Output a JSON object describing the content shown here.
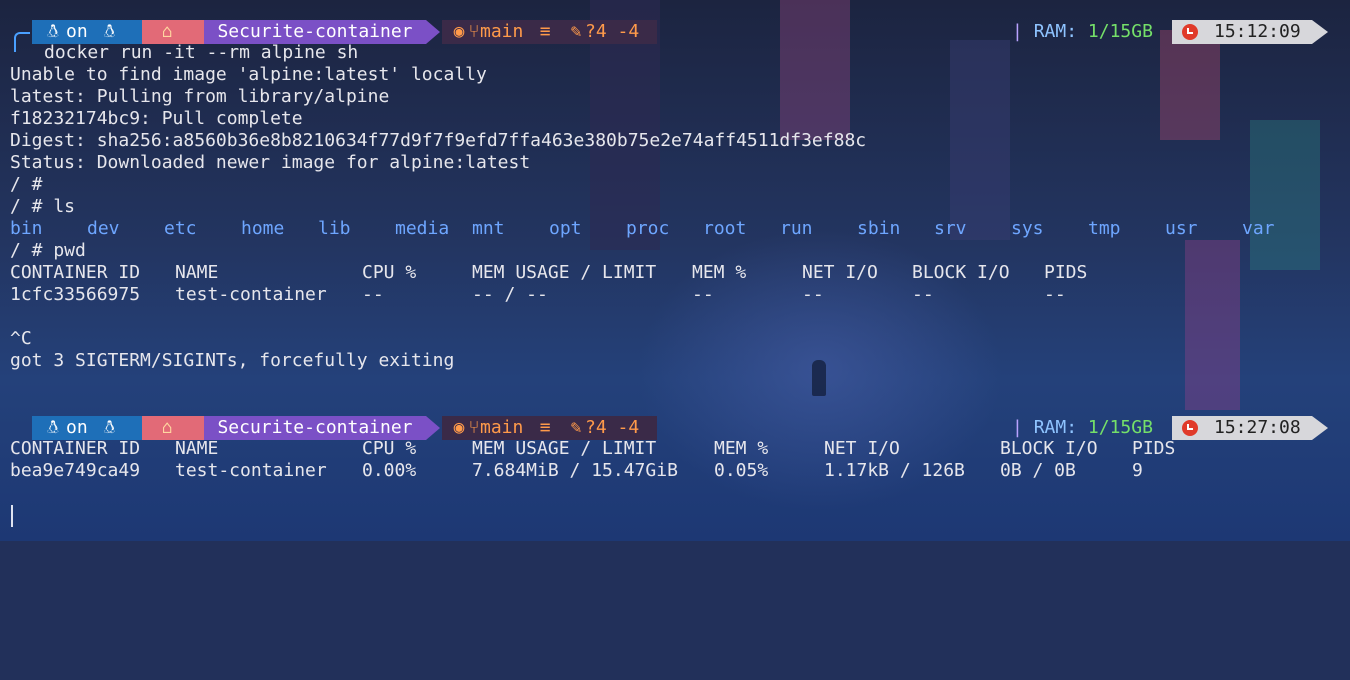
{
  "prompts": [
    {
      "os_icon": "linux-penguin-icon",
      "on_text": "on",
      "home_icon": "home-icon",
      "directory": "Securite-container",
      "git_icon": "github-icon",
      "branch_icon": "git-branch-icon",
      "branch": "main",
      "ahead_icon": "equal-sign-icon",
      "edit_icon": "edit-icon",
      "git_status": "?4 -4",
      "pipe": "|",
      "ram_label": "RAM:",
      "ram_value": "1/15GB",
      "time_icon": "alarm-clock-icon",
      "time": "15:12:09"
    },
    {
      "os_icon": "linux-penguin-icon",
      "on_text": "on",
      "home_icon": "home-icon",
      "directory": "Securite-container",
      "git_icon": "github-icon",
      "branch_icon": "git-branch-icon",
      "branch": "main",
      "ahead_icon": "equal-sign-icon",
      "edit_icon": "edit-icon",
      "git_status": "?4 -4",
      "pipe": "|",
      "ram_label": "RAM:",
      "ram_value": "1/15GB",
      "time_icon": "alarm-clock-icon",
      "time": "15:27:08"
    }
  ],
  "block1": {
    "command": "docker run -it --rm alpine sh",
    "output": [
      "Unable to find image 'alpine:latest' locally",
      "latest: Pulling from library/alpine",
      "f18232174bc9: Pull complete",
      "Digest: sha256:a8560b36e8b8210634f77d9f7f9efd7ffa463e380b75e2e74aff4511df3ef88c",
      "Status: Downloaded newer image for alpine:latest",
      "/ #",
      "/ # ls"
    ],
    "ls_items": [
      "bin",
      "dev",
      "etc",
      "home",
      "lib",
      "media",
      "mnt",
      "opt",
      "proc",
      "root",
      "run",
      "sbin",
      "srv",
      "sys",
      "tmp",
      "usr",
      "var"
    ],
    "pwd_line": "/ # pwd",
    "stats_headers": [
      "CONTAINER ID",
      "NAME",
      "CPU %",
      "MEM USAGE / LIMIT",
      "MEM %",
      "NET I/O",
      "BLOCK I/O",
      "PIDS"
    ],
    "stats_row": [
      "1cfc33566975",
      "test-container",
      "--",
      "-- / --",
      "--",
      "--",
      "--",
      "--"
    ],
    "interrupt": "^C",
    "exit_msg": "got 3 SIGTERM/SIGINTs, forcefully exiting"
  },
  "block2": {
    "stats_headers": [
      "CONTAINER ID",
      "NAME",
      "CPU %",
      "MEM USAGE / LIMIT",
      "MEM %",
      "NET I/O",
      "BLOCK I/O",
      "PIDS"
    ],
    "stats_row": [
      "bea9e749ca49",
      "test-container",
      "0.00%",
      "7.684MiB / 15.47GiB",
      "0.05%",
      "1.17kB / 126B",
      "0B / 0B",
      "9"
    ]
  },
  "colors": {
    "background": "#22305a",
    "segment_os": "#1e6fb8",
    "segment_home": "#e26a77",
    "segment_dir": "#7b50c6",
    "git": "#ff9a4a",
    "ram_value": "#75e069",
    "ls_items": "#6ea6ff"
  }
}
